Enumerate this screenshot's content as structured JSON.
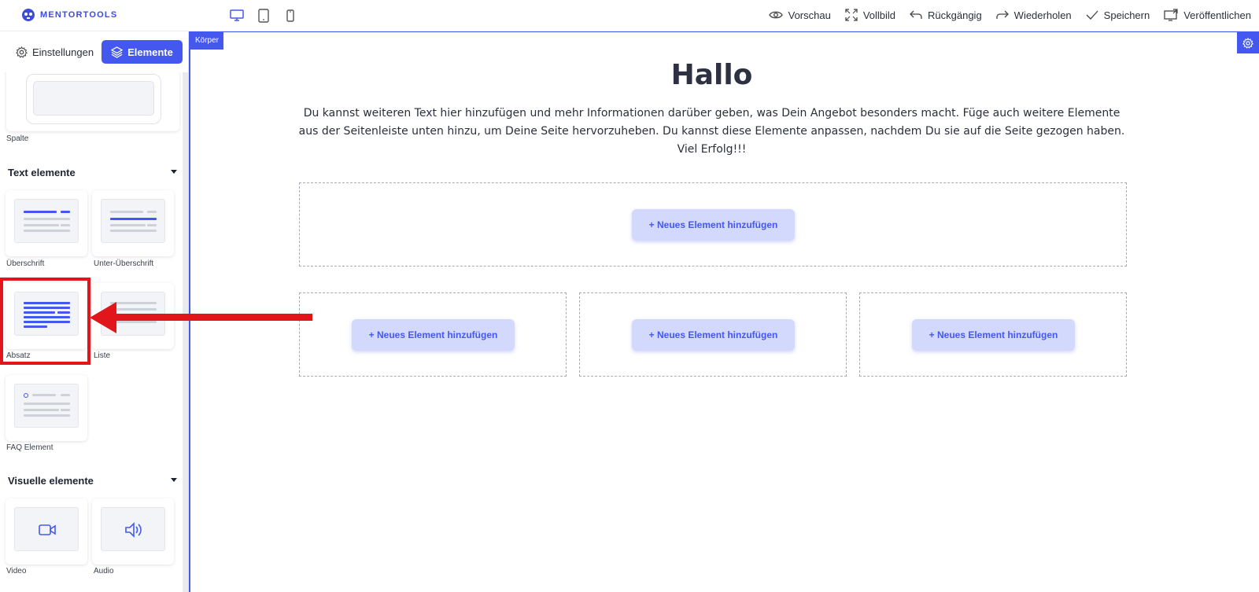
{
  "header": {
    "logo_text": "MENTORTOOLS",
    "devices": [
      "desktop-icon",
      "tablet-icon",
      "mobile-icon"
    ],
    "actions": [
      {
        "label": "Vorschau",
        "icon": "eye-icon"
      },
      {
        "label": "Vollbild",
        "icon": "fullscreen-icon"
      },
      {
        "label": "Rückgängig",
        "icon": "undo-icon"
      },
      {
        "label": "Wiederholen",
        "icon": "redo-icon"
      },
      {
        "label": "Speichern",
        "icon": "check-icon"
      },
      {
        "label": "Veröffentlichen",
        "icon": "publish-icon"
      }
    ]
  },
  "sidebar": {
    "tabs": {
      "settings": "Einstellungen",
      "elements": "Elemente"
    },
    "layout_tile": "Spalte",
    "sections": [
      {
        "title": "Text elemente",
        "items": [
          "Überschrift",
          "Unter-Überschrift",
          "Absatz",
          "Liste",
          "FAQ Element"
        ]
      },
      {
        "title": "Visuelle elemente",
        "items": [
          "Video",
          "Audio"
        ]
      }
    ]
  },
  "canvas": {
    "body_tag": "Körper",
    "headline": "Hallo",
    "intro": "Du kannst weiteren Text hier hinzufügen und mehr Informationen darüber geben, was Dein Angebot besonders macht. Füge auch weitere Elemente aus der Seitenleiste unten hinzu, um Deine Seite hervorzuheben. Du kannst diese Elemente anpassen, nachdem Du sie auf die Seite gezogen haben. Viel Erfolg!!!",
    "add_button": "+ Neues Element hinzufügen"
  },
  "colors": {
    "accent": "#4458f0",
    "highlight": "#e0161b",
    "button_bg": "#d3d9fc"
  }
}
